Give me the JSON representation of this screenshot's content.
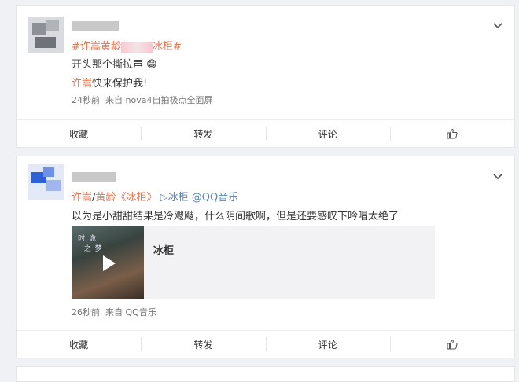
{
  "post1": {
    "topic_prefix": "#许嵩黄龄",
    "topic_suffix": "冰柜#",
    "body": "开头那个撕拉声",
    "emoji": "😁",
    "mention_name": "许嵩",
    "mention_text": "快来保护我!",
    "time": "24秒前",
    "source": "来自 nova4自拍极点全面屏"
  },
  "post2": {
    "artist_a": "许嵩",
    "slash": "/",
    "artist_b": "黄龄",
    "song_quoted": "《冰柜》",
    "play_link": "▷冰柜",
    "qq_link": "@QQ音乐",
    "body": "以为是小甜甜结果是冷飕飕，什么阴间歌啊，但是还要感叹下吟唱太绝了",
    "music_card": {
      "title": "冰柜",
      "cover_text": "时 诡\n  之 梦"
    },
    "time": "26秒前",
    "source": "来自 QQ音乐"
  },
  "actions": {
    "favorite": "收藏",
    "repost": "转发",
    "comment": "评论"
  },
  "icons": {
    "more": "chevron-down-icon",
    "like": "thumbs-up-icon",
    "play": "play-icon"
  },
  "colors": {
    "topic": "#eb7350",
    "link_blue": "#5d86b6",
    "background": "#f0f1f4"
  }
}
